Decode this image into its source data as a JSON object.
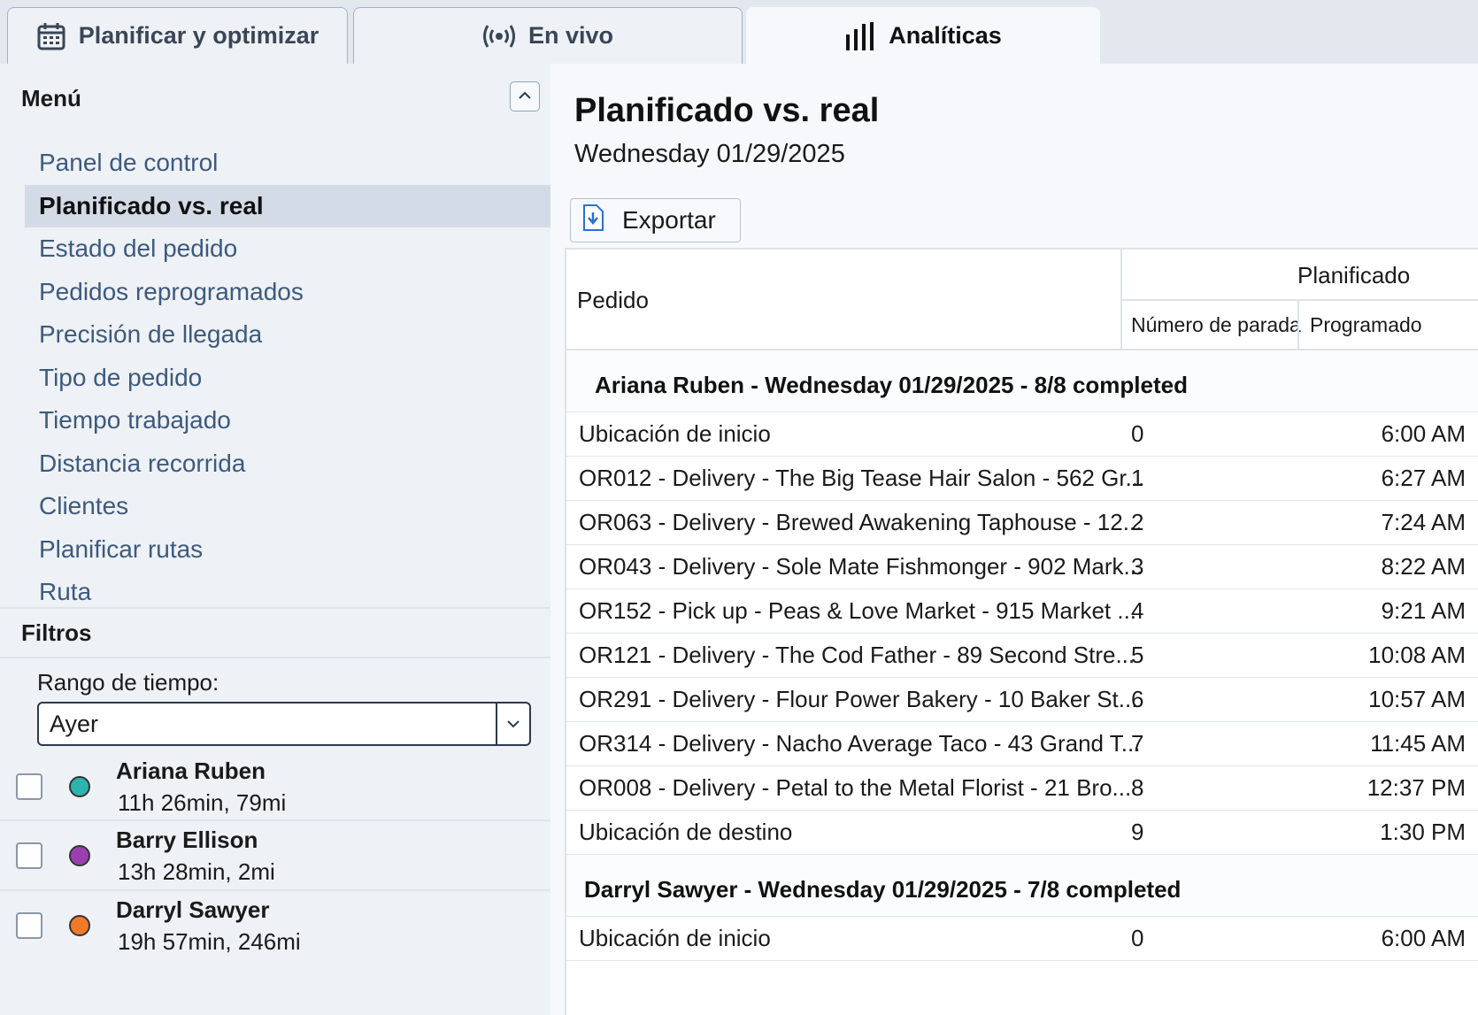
{
  "tabs": [
    {
      "label": "Planificar y optimizar",
      "icon": "calendar-icon"
    },
    {
      "label": "En vivo",
      "icon": "broadcast-icon"
    },
    {
      "label": "Analíticas",
      "icon": "bar-chart-icon"
    }
  ],
  "sidebar": {
    "menu_title": "Menú",
    "items": [
      {
        "label": "Panel de control"
      },
      {
        "label": "Planificado vs. real"
      },
      {
        "label": "Estado del pedido"
      },
      {
        "label": "Pedidos reprogramados"
      },
      {
        "label": "Precisión de llegada"
      },
      {
        "label": "Tipo de pedido"
      },
      {
        "label": "Tiempo trabajado"
      },
      {
        "label": "Distancia recorrida"
      },
      {
        "label": "Clientes"
      },
      {
        "label": "Planificar rutas"
      },
      {
        "label": "Ruta"
      }
    ],
    "active_item": "Planificado vs. real",
    "filters_title": "Filtros",
    "time_range_label": "Rango de tiempo:",
    "time_range_value": "Ayer",
    "drivers": [
      {
        "name": "Ariana Ruben",
        "stats": "11h 26min, 79mi",
        "color": "#2fb3ad",
        "checked": false
      },
      {
        "name": "Barry Ellison",
        "stats": "13h 28min, 2mi",
        "color": "#9b3fb0",
        "checked": false
      },
      {
        "name": "Darryl Sawyer",
        "stats": "19h 57min, 246mi",
        "color": "#f07a2a",
        "checked": false
      }
    ]
  },
  "main": {
    "title": "Planificado vs. real",
    "date": "Wednesday 01/29/2025",
    "export_label": "Exportar",
    "table": {
      "col_order": "Pedido",
      "group_planned": "Planificado",
      "col_stop": "Número de parada",
      "col_scheduled": "Programado",
      "groups": [
        {
          "header": "Ariana Ruben - Wednesday 01/29/2025 - 8/8 completed",
          "rows": [
            {
              "order": "Ubicación de inicio",
              "stop": "0",
              "scheduled": "6:00 AM"
            },
            {
              "order": "OR012 - Delivery - The Big Tease Hair Salon - 562 Gr...",
              "stop": "1",
              "scheduled": "6:27 AM"
            },
            {
              "order": "OR063 - Delivery - Brewed Awakening Taphouse - 12...",
              "stop": "2",
              "scheduled": "7:24 AM"
            },
            {
              "order": "OR043 - Delivery - Sole Mate Fishmonger - 902 Mark...",
              "stop": "3",
              "scheduled": "8:22 AM"
            },
            {
              "order": "OR152 - Pick up - Peas & Love Market - 915 Market ...",
              "stop": "4",
              "scheduled": "9:21 AM"
            },
            {
              "order": "OR121 - Delivery - The Cod Father - 89 Second Stre...",
              "stop": "5",
              "scheduled": "10:08 AM"
            },
            {
              "order": "OR291 - Delivery - Flour Power Bakery - 10 Baker St...",
              "stop": "6",
              "scheduled": "10:57 AM"
            },
            {
              "order": "OR314 - Delivery - Nacho Average Taco - 43 Grand T...",
              "stop": "7",
              "scheduled": "11:45 AM"
            },
            {
              "order": "OR008 - Delivery - Petal to the Metal Florist - 21 Bro...",
              "stop": "8",
              "scheduled": "12:37 PM"
            },
            {
              "order": "Ubicación de destino",
              "stop": "9",
              "scheduled": "1:30 PM"
            }
          ]
        },
        {
          "header": "Darryl Sawyer - Wednesday 01/29/2025 - 7/8 completed",
          "rows": [
            {
              "order": "Ubicación de inicio",
              "stop": "0",
              "scheduled": "6:00 AM"
            }
          ]
        }
      ]
    }
  },
  "colors": {
    "accent": "#3d5a7e",
    "active_bg": "#d3dbe6",
    "export_icon": "#2b6fd6"
  }
}
